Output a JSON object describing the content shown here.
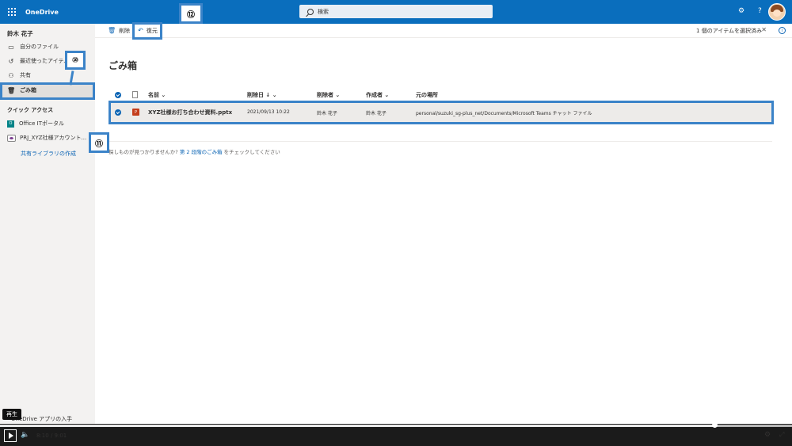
{
  "header": {
    "app_name": "OneDrive",
    "search_placeholder": "検索",
    "settings_icon": "gear-icon",
    "help_label": "?"
  },
  "sidebar": {
    "user_name": "鈴木 花子",
    "items": [
      {
        "label": "自分のファイル",
        "icon": "folder-icon"
      },
      {
        "label": "最近使ったアイテム",
        "icon": "recent-icon"
      },
      {
        "label": "共有",
        "icon": "share-icon"
      },
      {
        "label": "ごみ箱",
        "icon": "trash-icon"
      }
    ],
    "quick_access_title": "クイック アクセス",
    "quick_access": [
      {
        "label": "Office ITポータル",
        "icon_letter": "O"
      },
      {
        "label": "PRJ_XYZ社様アカウント..."
      }
    ],
    "create_library": "共有ライブラリの作成",
    "get_app": "OneDrive アプリの入手"
  },
  "commandbar": {
    "delete_label": "削除",
    "restore_label": "復元",
    "selection_info": "1 個のアイテムを選択済み"
  },
  "main": {
    "title": "ごみ箱",
    "columns": {
      "name": "名前",
      "deleted_date": "削除日",
      "deleted_by": "削除者",
      "created_by": "作成者",
      "original_location": "元の場所"
    },
    "rows": [
      {
        "name": "XYZ社様お打ち合わせ資料.pptx",
        "deleted_date": "2021/09/13 10:22",
        "deleted_by": "鈴木 花子",
        "created_by": "鈴木 花子",
        "original_location": "personal/suzuki_sg-plus_net/Documents/Microsoft Teams チャット ファイル"
      }
    ],
    "footer_prefix": "探しものが見つかりませんか? ",
    "footer_link": "第 2 段階のごみ箱",
    "footer_suffix": " をチェックしてください"
  },
  "annotations": {
    "a10": "⑩",
    "a11": "⑪",
    "a12": "⑫"
  },
  "video": {
    "tooltip": "再生",
    "time": "8:10 / 9:01",
    "progress": 0.902
  }
}
